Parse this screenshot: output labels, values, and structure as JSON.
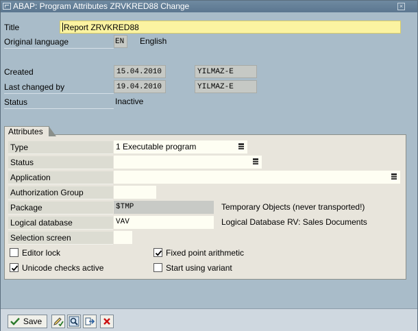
{
  "window": {
    "title": "ABAP: Program Attributes ZRVKRED88 Change",
    "close_glyph": "×"
  },
  "header": {
    "title_label": "Title",
    "title_value": "Report ZRVKRED88",
    "orig_lang_label": "Original language",
    "orig_lang_code": "EN",
    "orig_lang_name": "English",
    "created_label": "Created",
    "created_date": "15.04.2010",
    "created_user": "YILMAZ-E",
    "changed_label": "Last changed by",
    "changed_date": "19.04.2010",
    "changed_user": "YILMAZ-E",
    "status_label": "Status",
    "status_value": "Inactive"
  },
  "attributes": {
    "group_title": "Attributes",
    "type_label": "Type",
    "type_value": "1 Executable program",
    "status_label": "Status",
    "status_value": "",
    "application_label": "Application",
    "application_value": "",
    "auth_group_label": "Authorization Group",
    "auth_group_value": "",
    "package_label": "Package",
    "package_value": "$TMP",
    "package_desc": "Temporary Objects (never transported!)",
    "logdb_label": "Logical database",
    "logdb_value": "VAV",
    "logdb_desc": "Logical Database RV: Sales Documents",
    "selscreen_label": "Selection screen",
    "selscreen_value": "",
    "checkboxes": {
      "editor_lock": {
        "label": "Editor lock",
        "checked": false
      },
      "fixed_point": {
        "label": "Fixed point arithmetic",
        "checked": true
      },
      "unicode": {
        "label": "Unicode checks active",
        "checked": true
      },
      "start_variant": {
        "label": "Start using variant",
        "checked": false
      }
    }
  },
  "toolbar": {
    "save_label": "Save",
    "icons": [
      "check-icon",
      "edit-pencil-icon",
      "find-icon",
      "transport-icon",
      "cancel-icon"
    ],
    "colors": {
      "save_check": "#2a7a2a",
      "cancel": "#cc1111"
    }
  }
}
